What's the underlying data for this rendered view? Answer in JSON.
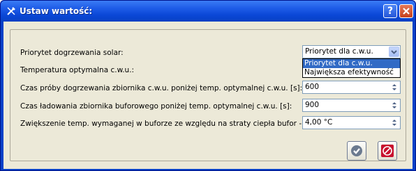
{
  "window": {
    "title": "Ustaw wartość:"
  },
  "rows": [
    {
      "label": "Priorytet dogrzewania solar:"
    },
    {
      "label": "Temperatura optymalna c.w.u.:"
    },
    {
      "label": "Czas próby dogrzewania zbiornika c.w.u. poniżej temp. optymalnej c.w.u. [s]:"
    },
    {
      "label": "Czas ładowania zbiornika buforowego poniżej temp. optymalnej c.w.u. [s]:"
    },
    {
      "label": "Zwiększenie temp. wymaganej w buforze ze względu na straty ciepła bufor - c.o.:"
    }
  ],
  "combo": {
    "value": "Priorytet dla c.w.u.",
    "options": [
      "Priorytet dla c.w.u.",
      "Największa efektywność"
    ],
    "highlighted_index": 0
  },
  "spinners": [
    {
      "value": "600"
    },
    {
      "value": "900"
    },
    {
      "value": "4,00 °C"
    }
  ],
  "buttons": {
    "ok": "check-icon",
    "cancel": "no-entry-icon"
  },
  "colors": {
    "title_bar": "#0a47d6",
    "client": "#ece9d8",
    "selection": "#316ac5",
    "cancel_icon": "#c8102e",
    "ok_icon": "#6b7a8f"
  }
}
